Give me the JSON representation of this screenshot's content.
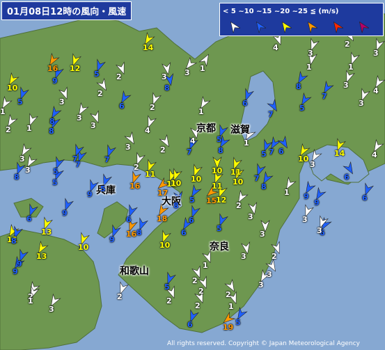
{
  "title": "01月08日12時の風向・風速",
  "legend": {
    "unit": "(m/s)",
    "ranges": [
      "< 5",
      "~10",
      "~15",
      "~20",
      "~25",
      "≦"
    ],
    "colors": [
      "#ffffff",
      "#1e60ff",
      "#ffff00",
      "#ff9900",
      "#ff2800",
      "#b40068"
    ]
  },
  "cities": [
    {
      "name": "京都"
    },
    {
      "name": "滋賀"
    },
    {
      "name": "兵庫"
    },
    {
      "name": "大阪"
    },
    {
      "name": "奈良"
    },
    {
      "name": "和歌山"
    }
  ],
  "stations": [
    {
      "speed": 16
    },
    {
      "speed": 12
    },
    {
      "speed": 14
    },
    {
      "speed": 10
    },
    {
      "speed": 9
    },
    {
      "speed": 5
    },
    {
      "speed": 2
    },
    {
      "speed": 3
    },
    {
      "speed": 8
    },
    {
      "speed": 3
    },
    {
      "speed": 1
    },
    {
      "speed": 4
    },
    {
      "speed": 1
    },
    {
      "speed": 1
    },
    {
      "speed": 7
    },
    {
      "speed": 2
    },
    {
      "speed": 3
    },
    {
      "speed": 5
    },
    {
      "speed": 6
    },
    {
      "speed": 8
    },
    {
      "speed": 3
    },
    {
      "speed": 2
    },
    {
      "speed": 1
    },
    {
      "speed": 4
    },
    {
      "speed": 6
    },
    {
      "speed": 7
    },
    {
      "speed": 8
    },
    {
      "speed": 5
    },
    {
      "speed": 3
    },
    {
      "speed": 3
    },
    {
      "speed": 1
    },
    {
      "speed": 3
    },
    {
      "speed": 2
    },
    {
      "speed": 1
    },
    {
      "speed": 3
    },
    {
      "speed": 5
    },
    {
      "speed": 3
    },
    {
      "speed": 2
    },
    {
      "speed": 4
    },
    {
      "speed": 5
    },
    {
      "speed": 1
    },
    {
      "speed": 5
    },
    {
      "speed": 3
    },
    {
      "speed": 2
    },
    {
      "speed": 3
    },
    {
      "speed": 4
    },
    {
      "speed": 7
    },
    {
      "speed": 4
    },
    {
      "speed": 8
    },
    {
      "speed": 7
    },
    {
      "speed": 2
    },
    {
      "speed": 7
    },
    {
      "speed": 6
    },
    {
      "speed": 8
    },
    {
      "speed": 5
    },
    {
      "speed": 7
    },
    {
      "speed": 7
    },
    {
      "speed": 6
    },
    {
      "speed": 7
    },
    {
      "speed": 8
    },
    {
      "speed": 8
    },
    {
      "speed": 3
    },
    {
      "speed": 10
    },
    {
      "speed": 14
    },
    {
      "speed": 6
    },
    {
      "speed": 6
    },
    {
      "speed": 3
    },
    {
      "speed": 5
    },
    {
      "speed": 5
    },
    {
      "speed": 10
    },
    {
      "speed": 9
    },
    {
      "speed": 16
    },
    {
      "speed": 11
    },
    {
      "speed": 11
    },
    {
      "speed": 10
    },
    {
      "speed": 10
    },
    {
      "speed": 11
    },
    {
      "speed": 11
    },
    {
      "speed": 17
    },
    {
      "speed": 12
    },
    {
      "speed": 15
    },
    {
      "speed": 10
    },
    {
      "speed": 9
    },
    {
      "speed": 8
    },
    {
      "speed": 6
    },
    {
      "speed": 9
    },
    {
      "speed": 2
    },
    {
      "speed": 9
    },
    {
      "speed": 11
    },
    {
      "speed": 6
    },
    {
      "speed": 13
    },
    {
      "speed": 9
    },
    {
      "speed": 10
    },
    {
      "speed": 18
    },
    {
      "speed": 6
    },
    {
      "speed": 13
    },
    {
      "speed": 16
    },
    {
      "speed": 9
    },
    {
      "speed": 8
    },
    {
      "speed": 10
    },
    {
      "speed": 5
    },
    {
      "speed": 9
    },
    {
      "speed": 6
    },
    {
      "speed": 8
    },
    {
      "speed": 3
    },
    {
      "speed": 3
    },
    {
      "speed": 2
    },
    {
      "speed": 3
    },
    {
      "speed": 3
    },
    {
      "speed": 2
    },
    {
      "speed": 2
    },
    {
      "speed": 2
    },
    {
      "speed": 3
    },
    {
      "speed": 1
    },
    {
      "speed": 3
    },
    {
      "speed": 2
    },
    {
      "speed": 3
    },
    {
      "speed": 1
    },
    {
      "speed": 3
    },
    {
      "speed": 5
    },
    {
      "speed": 2
    },
    {
      "speed": 1
    },
    {
      "speed": 2
    },
    {
      "speed": 2
    },
    {
      "speed": 6
    },
    {
      "speed": 19
    },
    {
      "speed": 1
    },
    {
      "speed": 5
    }
  ],
  "copyright": "All rights reserved. Copyright © Japan Meteorological Agency"
}
